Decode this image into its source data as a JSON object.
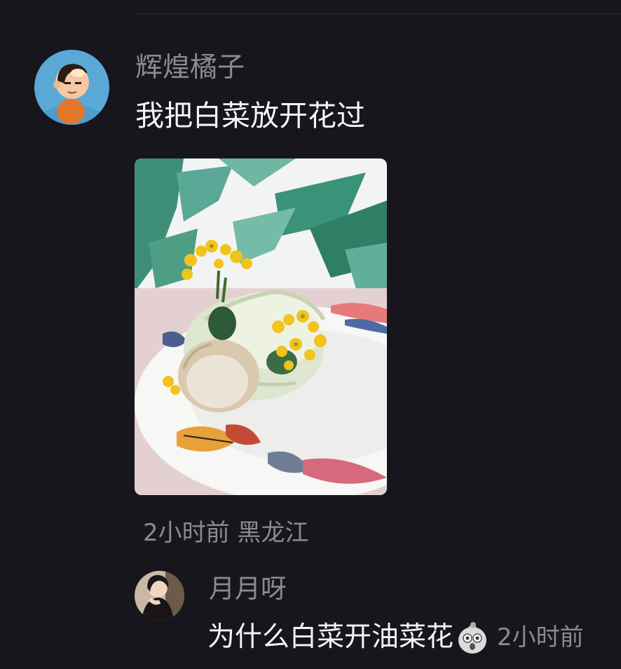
{
  "comment1": {
    "author": "辉煌橘子",
    "text": "我把白菜放开花过",
    "time": "2小时前",
    "location": "黑龙江",
    "avatar_icon": "cartoon-child-avatar",
    "image": "cabbage-with-rapeseed-flowers-on-fish-plate"
  },
  "reply1": {
    "author": "月月呀",
    "text": "为什么白菜开油菜花",
    "emoji": "shocked-face-emoji",
    "time": "2小时前",
    "avatar_icon": "girl-photo-avatar"
  },
  "colors": {
    "background": "#17161c",
    "name": "#8b8a90",
    "text": "#f4f4f6"
  }
}
